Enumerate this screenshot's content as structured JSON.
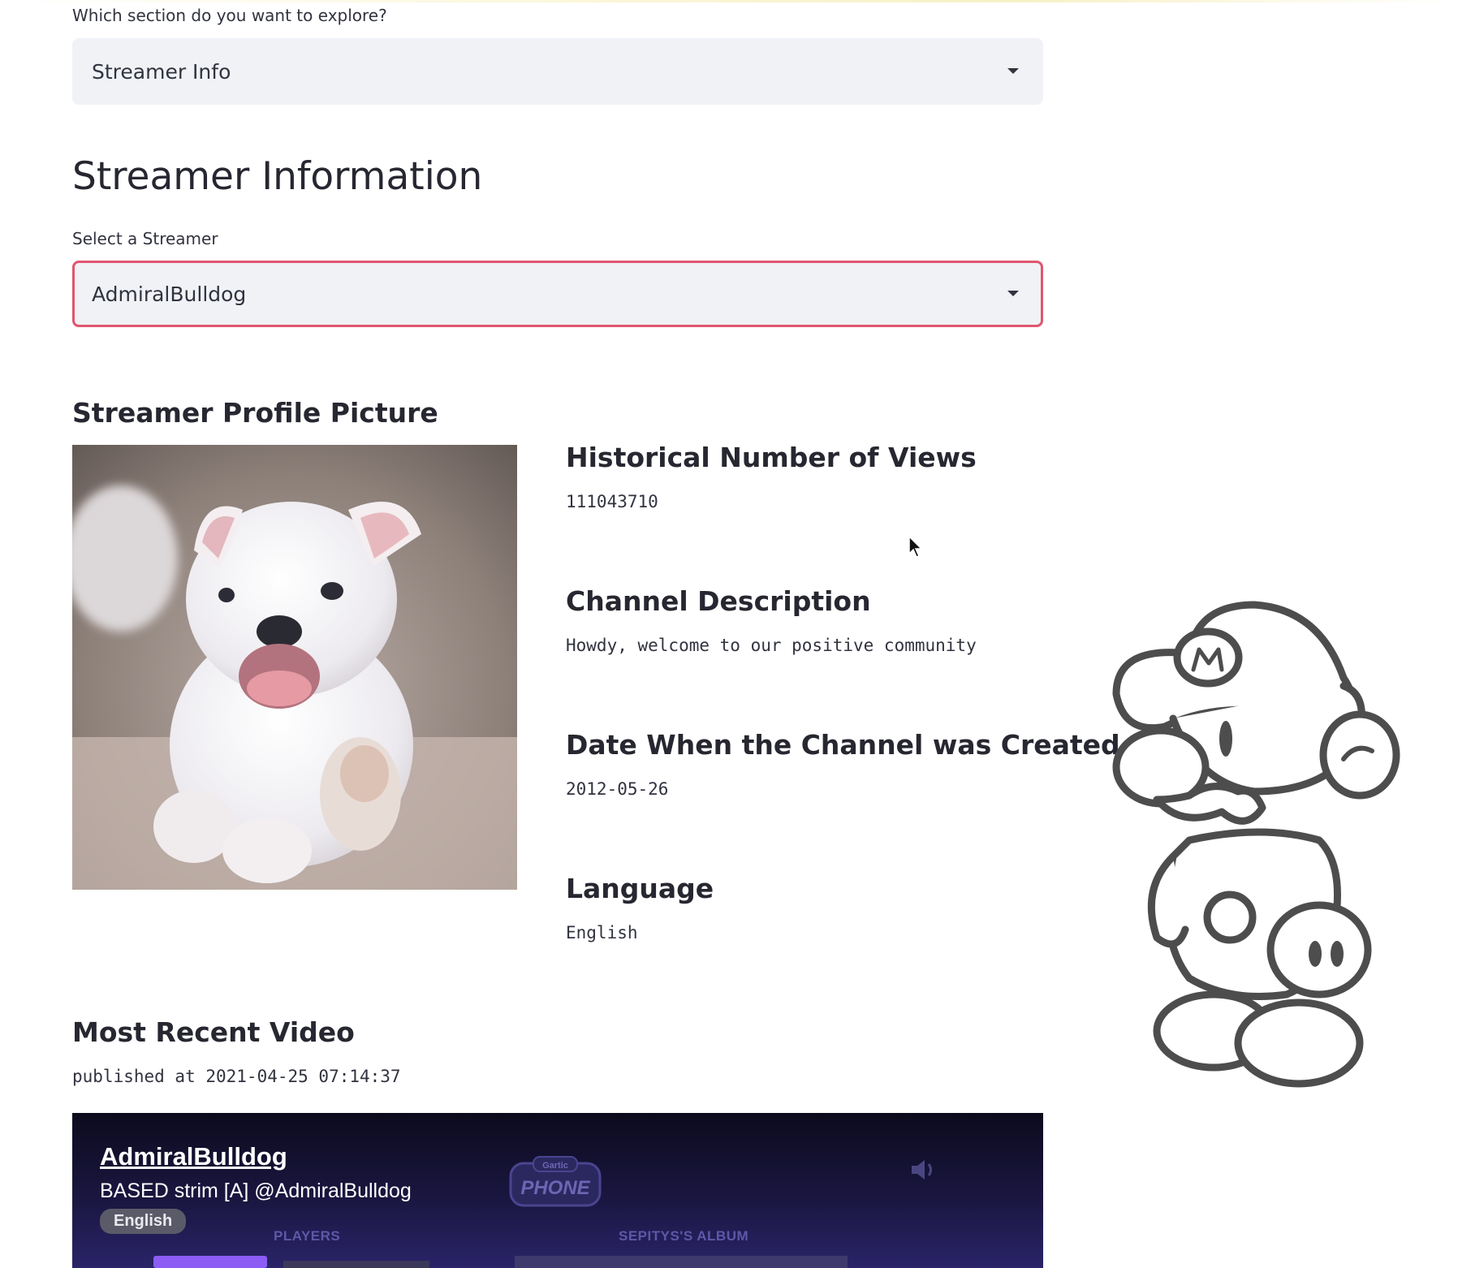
{
  "section_select": {
    "label": "Which section do you want to explore?",
    "value": "Streamer Info"
  },
  "page_title": "Streamer Information",
  "streamer_select": {
    "label": "Select a Streamer",
    "value": "AdmiralBulldog"
  },
  "profile": {
    "heading": "Streamer Profile Picture",
    "image_desc": "white bulldog puppy"
  },
  "stats": {
    "views_label": "Historical Number of Views",
    "views_value": "111043710",
    "desc_label": "Channel Description",
    "desc_value": "Howdy, welcome to our positive community",
    "created_label": "Date When the Channel was Created",
    "created_value": "2012-05-26",
    "language_label": "Language",
    "language_value": "English"
  },
  "recent_video": {
    "heading": "Most Recent Video",
    "published": "published at 2021-04-25 07:14:37",
    "embed": {
      "channel": "AdmiralBulldog",
      "title": "BASED strim [A] @AdmiralBulldog",
      "language_badge": "English",
      "section_players": "PLAYERS",
      "section_album": "SEPITYS'S ALBUM",
      "logo_text": "Gartic PHONE"
    }
  },
  "colors": {
    "focus_border": "#e0566f",
    "select_bg": "#f0f2f6",
    "text": "#262730"
  },
  "icons": [
    "chevron-down-icon",
    "audio-icon",
    "mouse-cursor-icon"
  ]
}
